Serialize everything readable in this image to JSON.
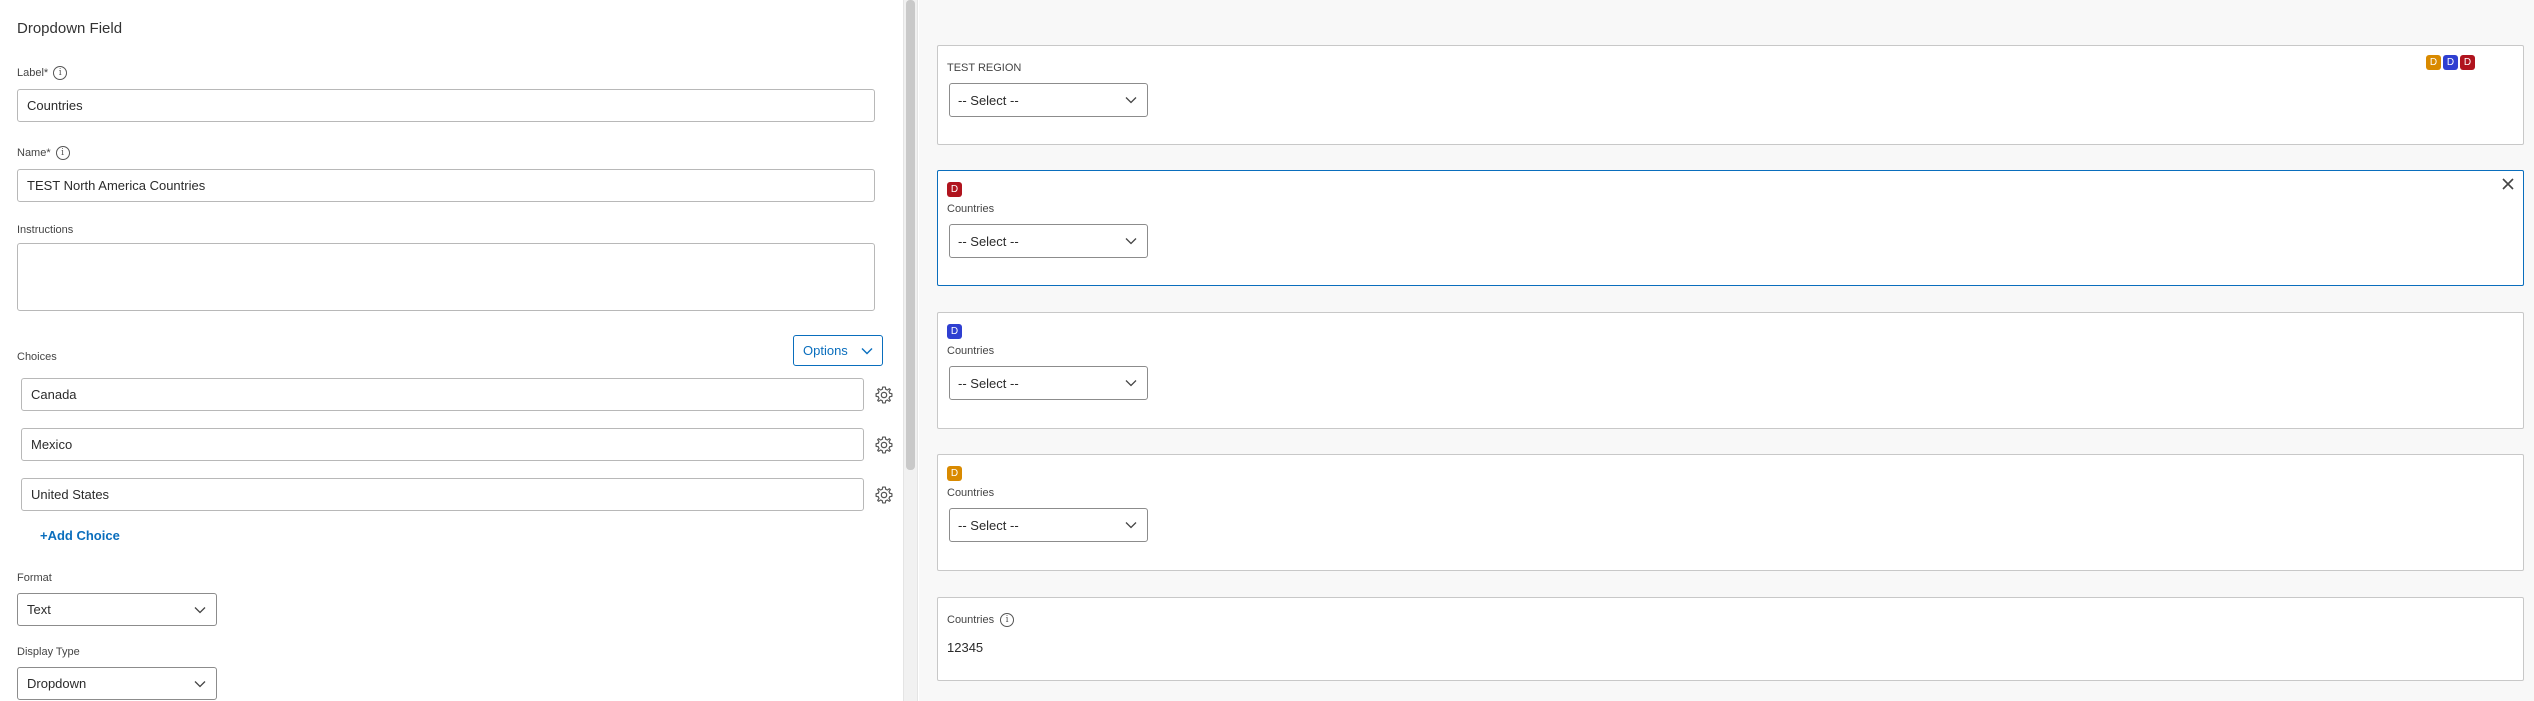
{
  "editor": {
    "title": "Dropdown Field",
    "label_field": {
      "label": "Label*",
      "value": "Countries"
    },
    "name_field": {
      "label": "Name*",
      "value": "TEST North America Countries"
    },
    "instructions": {
      "label": "Instructions",
      "value": ""
    },
    "choices": {
      "label": "Choices",
      "options_button": "Options",
      "items": [
        "Canada",
        "Mexico",
        "United States"
      ],
      "add_choice": "+Add Choice"
    },
    "format": {
      "label": "Format",
      "value": "Text"
    },
    "display_type": {
      "label": "Display Type",
      "value": "Dropdown"
    }
  },
  "preview": {
    "cards": [
      {
        "label": "TEST REGION",
        "select": "-- Select --",
        "badges": [
          "D",
          "D",
          "D"
        ]
      },
      {
        "label": "Countries",
        "select": "-- Select --",
        "badge": "D"
      },
      {
        "label": "Countries",
        "select": "-- Select --",
        "badge": "D"
      },
      {
        "label": "Countries",
        "select": "-- Select --",
        "badge": "D"
      },
      {
        "label": "Countries",
        "value": "12345"
      }
    ]
  },
  "colors": {
    "accent": "#0a6ebd",
    "badge_orange": "#d98a00",
    "badge_blue": "#2f3fd1",
    "badge_red": "#b0141e"
  }
}
